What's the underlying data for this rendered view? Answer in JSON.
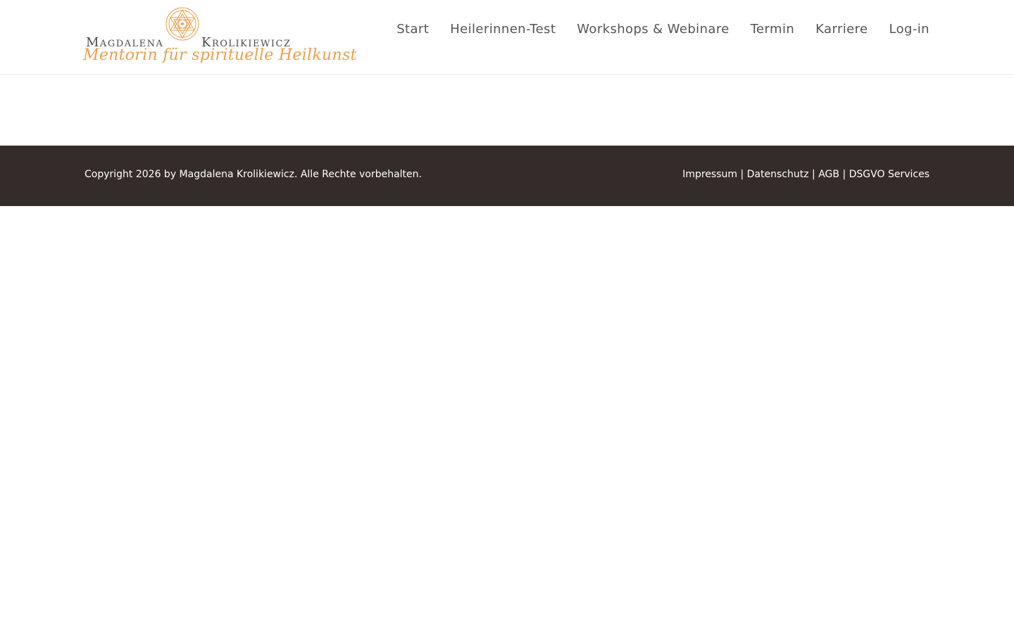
{
  "colors": {
    "accent": "#e8a04a",
    "nav_text": "#555555",
    "footer_bg": "#342c2a",
    "footer_text": "#ffffff"
  },
  "logo": {
    "icon": "sri-yantra-icon",
    "first_name": "Magdalena",
    "last_name": "Krolikiewicz",
    "tagline": "Mentorin für spirituelle Heilkunst"
  },
  "nav": {
    "items": [
      {
        "label": "Start"
      },
      {
        "label": "Heilerinnen-Test"
      },
      {
        "label": "Workshops & Webinare"
      },
      {
        "label": "Termin"
      },
      {
        "label": "Karriere"
      },
      {
        "label": "Log-in"
      }
    ]
  },
  "footer": {
    "copyright": "Copyright 2026 by Magdalena Krolikiewicz. Alle Rechte vorbehalten.",
    "links": [
      {
        "label": "Impressum"
      },
      {
        "label": "Datenschutz"
      },
      {
        "label": "AGB"
      },
      {
        "label": "DSGVO Services"
      }
    ],
    "separator": "|"
  }
}
